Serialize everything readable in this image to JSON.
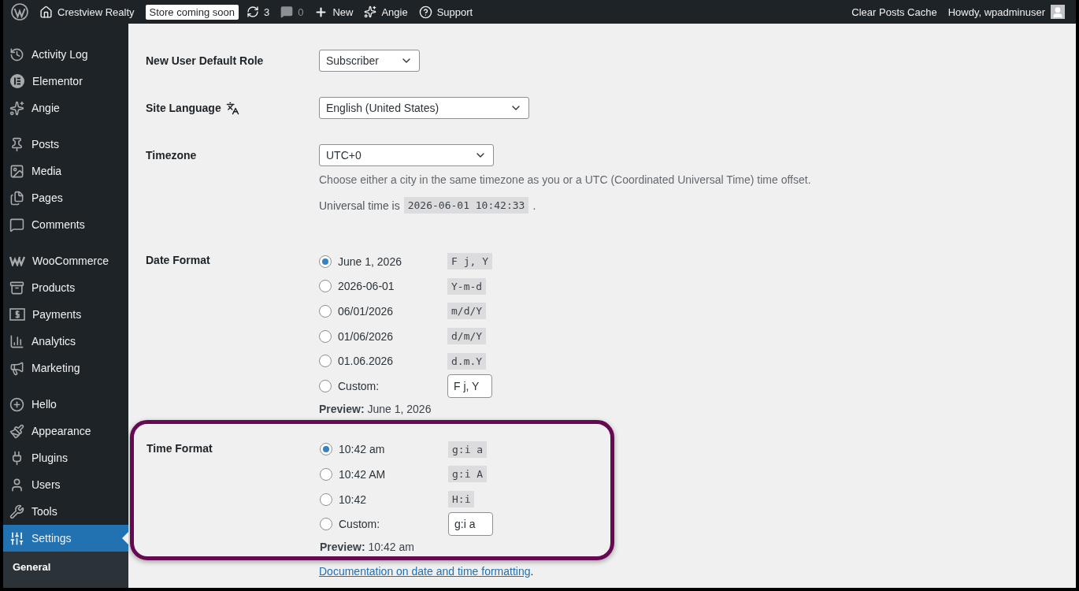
{
  "admin_bar": {
    "site_name": "Crestview Realty",
    "store_badge": "Store coming soon",
    "updates_count": "3",
    "comments_count": "0",
    "new_label": "New",
    "angie_label": "Angie",
    "support_label": "Support",
    "clear_cache": "Clear Posts Cache",
    "greeting": "Howdy, wpadminuser"
  },
  "sidebar": {
    "groups": [
      [
        {
          "label": "Activity Log",
          "selected": false
        },
        {
          "label": "Elementor",
          "selected": false
        },
        {
          "label": "Angie",
          "selected": false
        }
      ],
      [
        {
          "label": "Posts",
          "selected": false
        },
        {
          "label": "Media",
          "selected": false
        },
        {
          "label": "Pages",
          "selected": false
        },
        {
          "label": "Comments",
          "selected": false
        }
      ],
      [
        {
          "label": "WooCommerce",
          "selected": false
        },
        {
          "label": "Products",
          "selected": false
        },
        {
          "label": "Payments",
          "selected": false
        },
        {
          "label": "Analytics",
          "selected": false
        },
        {
          "label": "Marketing",
          "selected": false
        }
      ],
      [
        {
          "label": "Hello",
          "selected": false
        },
        {
          "label": "Appearance",
          "selected": false
        },
        {
          "label": "Plugins",
          "selected": false
        },
        {
          "label": "Users",
          "selected": false
        },
        {
          "label": "Tools",
          "selected": false
        },
        {
          "label": "Settings",
          "selected": true
        }
      ]
    ],
    "submenu": [
      {
        "label": "General",
        "selected": true
      }
    ]
  },
  "settings": {
    "default_role": {
      "label": "New User Default Role",
      "value": "Subscriber"
    },
    "site_language": {
      "label": "Site Language",
      "value": "English (United States)"
    },
    "timezone": {
      "label": "Timezone",
      "value": "UTC+0",
      "description": "Choose either a city in the same timezone as you or a UTC (Coordinated Universal Time) time offset.",
      "universal_label": "Universal time is",
      "universal_value": "2026-06-01 10:42:33",
      "universal_suffix": "."
    },
    "date_format": {
      "label": "Date Format",
      "options": [
        {
          "label": "June 1, 2026",
          "code": "F j, Y",
          "selected": true
        },
        {
          "label": "2026-06-01",
          "code": "Y-m-d",
          "selected": false
        },
        {
          "label": "06/01/2026",
          "code": "m/d/Y",
          "selected": false
        },
        {
          "label": "01/06/2026",
          "code": "d/m/Y",
          "selected": false
        },
        {
          "label": "01.06.2026",
          "code": "d.m.Y",
          "selected": false
        }
      ],
      "custom": {
        "label": "Custom:",
        "value": "F j, Y",
        "selected": false
      },
      "preview": "**Preview:** June 1, 2026"
    },
    "time_format": {
      "label": "Time Format",
      "highlighted": true,
      "options": [
        {
          "label": "10:42 am",
          "code": "g:i a",
          "selected": true
        },
        {
          "label": "10:42 AM",
          "code": "g:i A",
          "selected": false
        },
        {
          "label": "10:42",
          "code": "H:i",
          "selected": false
        }
      ],
      "custom": {
        "label": "Custom:",
        "value": "g:i a",
        "selected": false
      },
      "preview": "**Preview:** 10:42 am"
    },
    "doc_link": "Documentation on date and time formatting",
    "doc_suffix": "."
  }
}
